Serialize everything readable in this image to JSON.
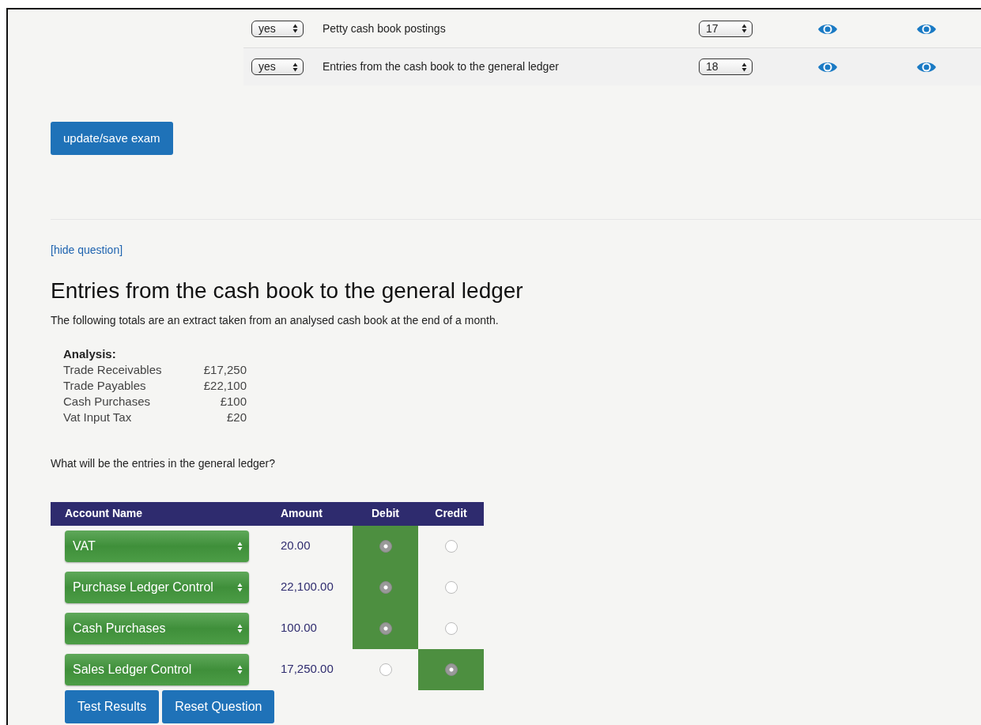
{
  "question_list": [
    {
      "included": "yes",
      "title": "Petty cash book postings",
      "order": "17"
    },
    {
      "included": "yes",
      "title": "Entries from the cash book to the general ledger",
      "order": "18"
    }
  ],
  "save_button": "update/save exam",
  "hide_link": "[hide question]",
  "question": {
    "title": "Entries from the cash book to the general ledger",
    "intro": "The following totals are an extract taken from an analysed cash book at the end of a month.",
    "analysis": {
      "heading": "Analysis:",
      "items": [
        {
          "label": "Trade Receivables",
          "amount": "£17,250"
        },
        {
          "label": "Trade Payables",
          "amount": "£22,100"
        },
        {
          "label": "Cash Purchases",
          "amount": "£100"
        },
        {
          "label": "Vat Input Tax",
          "amount": "£20"
        }
      ]
    },
    "prompt": "What will be the entries in the general ledger?",
    "answer_table": {
      "columns": [
        "Account Name",
        "Amount",
        "Debit",
        "Credit"
      ],
      "rows": [
        {
          "account": "VAT",
          "amount": "20.00",
          "debit": true,
          "credit": false
        },
        {
          "account": "Purchase Ledger Control",
          "amount": "22,100.00",
          "debit": true,
          "credit": false
        },
        {
          "account": "Cash Purchases",
          "amount": "100.00",
          "debit": true,
          "credit": false
        },
        {
          "account": "Sales Ledger Control",
          "amount": "17,250.00",
          "debit": false,
          "credit": true
        }
      ]
    },
    "buttons": [
      "Test Results",
      "Reset Question"
    ]
  }
}
